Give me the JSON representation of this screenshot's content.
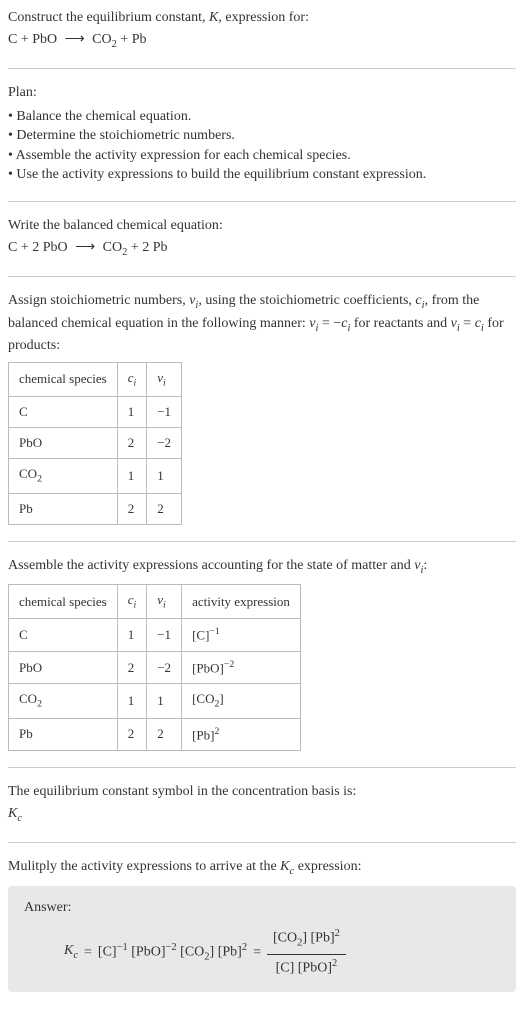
{
  "header": {
    "intro": "Construct the equilibrium constant, ",
    "k_symbol": "K",
    "intro2": ", expression for:",
    "equation_lhs": "C + PbO",
    "arrow": "⟶",
    "equation_rhs_1": "CO",
    "equation_rhs_sub": "2",
    "equation_rhs_2": " + Pb"
  },
  "plan": {
    "title": "Plan:",
    "items": [
      "• Balance the chemical equation.",
      "• Determine the stoichiometric numbers.",
      "• Assemble the activity expression for each chemical species.",
      "• Use the activity expressions to build the equilibrium constant expression."
    ]
  },
  "balanced": {
    "title": "Write the balanced chemical equation:",
    "lhs": "C + 2 PbO",
    "arrow": "⟶",
    "rhs1": "CO",
    "rhs_sub": "2",
    "rhs2": " + 2 Pb"
  },
  "stoich": {
    "text1": "Assign stoichiometric numbers, ",
    "nu_i": "ν",
    "nu_sub": "i",
    "text2": ", using the stoichiometric coefficients, ",
    "c_i": "c",
    "c_sub": "i",
    "text3": ", from the balanced chemical equation in the following manner: ",
    "eq_nu": "ν",
    "eq_i1": "i",
    "eq_text1": " = −",
    "eq_c": "c",
    "eq_i2": "i",
    "text4": " for reactants and ",
    "eq_nu2": "ν",
    "eq_i3": "i",
    "eq_text2": " = ",
    "eq_c2": "c",
    "eq_i4": "i",
    "text5": " for products:"
  },
  "table1": {
    "headers": [
      "chemical species",
      "c",
      "i",
      "ν",
      "i"
    ],
    "rows": [
      {
        "species": "C",
        "c": "1",
        "nu": "−1"
      },
      {
        "species": "PbO",
        "c": "2",
        "nu": "−2"
      },
      {
        "species_pre": "CO",
        "species_sub": "2",
        "c": "1",
        "nu": "1"
      },
      {
        "species": "Pb",
        "c": "2",
        "nu": "2"
      }
    ]
  },
  "activity": {
    "text1": "Assemble the activity expressions accounting for the state of matter and ",
    "nu": "ν",
    "nu_sub": "i",
    "text2": ":"
  },
  "table2": {
    "headers": [
      "chemical species",
      "c",
      "i",
      "ν",
      "i",
      "activity expression"
    ],
    "rows": [
      {
        "species": "C",
        "c": "1",
        "nu": "−1",
        "act_base": "[C]",
        "act_exp": "−1"
      },
      {
        "species": "PbO",
        "c": "2",
        "nu": "−2",
        "act_base": "[PbO]",
        "act_exp": "−2"
      },
      {
        "species_pre": "CO",
        "species_sub": "2",
        "c": "1",
        "nu": "1",
        "act_pre": "[CO",
        "act_sub": "2",
        "act_post": "]"
      },
      {
        "species": "Pb",
        "c": "2",
        "nu": "2",
        "act_base": "[Pb]",
        "act_exp": "2"
      }
    ]
  },
  "eq_const": {
    "text": "The equilibrium constant symbol in the concentration basis is:",
    "k": "K",
    "k_sub": "c"
  },
  "multiply": {
    "text1": "Mulitply the activity expressions to arrive at the ",
    "k": "K",
    "k_sub": "c",
    "text2": " expression:"
  },
  "answer": {
    "label": "Answer:",
    "k": "K",
    "k_sub": "c",
    "eq": " = ",
    "t1": "[C]",
    "t1_exp": "−1",
    "t2": " [PbO]",
    "t2_exp": "−2",
    "t3_pre": " [CO",
    "t3_sub": "2",
    "t3_post": "] [Pb]",
    "t3_exp": "2",
    "eq2": " = ",
    "num_pre": "[CO",
    "num_sub": "2",
    "num_post": "] [Pb]",
    "num_exp": "2",
    "den1": "[C] [PbO]",
    "den_exp": "2"
  }
}
